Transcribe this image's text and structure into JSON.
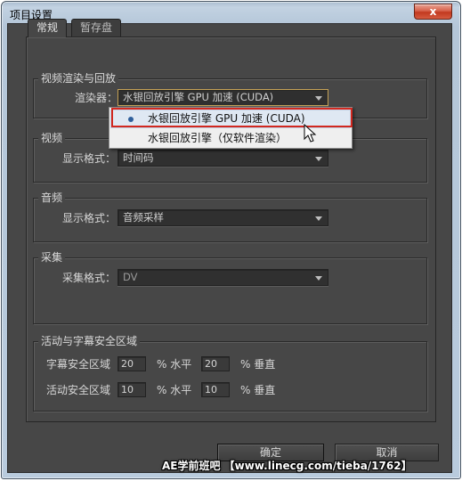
{
  "window": {
    "title": "项目设置",
    "close_glyph": "x"
  },
  "tabs": [
    {
      "label": "常规",
      "active": true
    },
    {
      "label": "暂存盘",
      "active": false
    }
  ],
  "groups": {
    "render": {
      "title": "视频渲染与回放",
      "renderer_label": "渲染器：",
      "renderer_value": "水银回放引擎 GPU 加速 (CUDA)"
    },
    "video": {
      "title": "视频",
      "format_label": "显示格式：",
      "format_value": "时间码"
    },
    "audio": {
      "title": "音频",
      "format_label": "显示格式：",
      "format_value": "音频采样"
    },
    "capture": {
      "title": "采集",
      "format_label": "采集格式：",
      "format_value": "DV"
    },
    "safe_zones": {
      "title": "活动与字幕安全区域",
      "title_safe_label": "字幕安全区域",
      "title_safe_h": "20",
      "title_safe_v": "20",
      "action_safe_label": "活动安全区域",
      "action_safe_h": "10",
      "action_safe_v": "10",
      "h_unit": "% 水平",
      "v_unit": "% 垂直"
    }
  },
  "renderer_popup": {
    "items": [
      {
        "label": "水银回放引擎 GPU 加速 (CUDA)",
        "selected": true
      },
      {
        "label": "水银回放引擎（仅软件渲染）",
        "selected": false
      }
    ]
  },
  "buttons": {
    "ok_label": "确定",
    "cancel_label": "取消"
  },
  "watermark": "AE学前班吧 【www.linecg.com/tieba/1762】",
  "colors": {
    "dialog_bg": "#474747",
    "highlight": "#d2281f",
    "focus_border": "#c5a256"
  }
}
